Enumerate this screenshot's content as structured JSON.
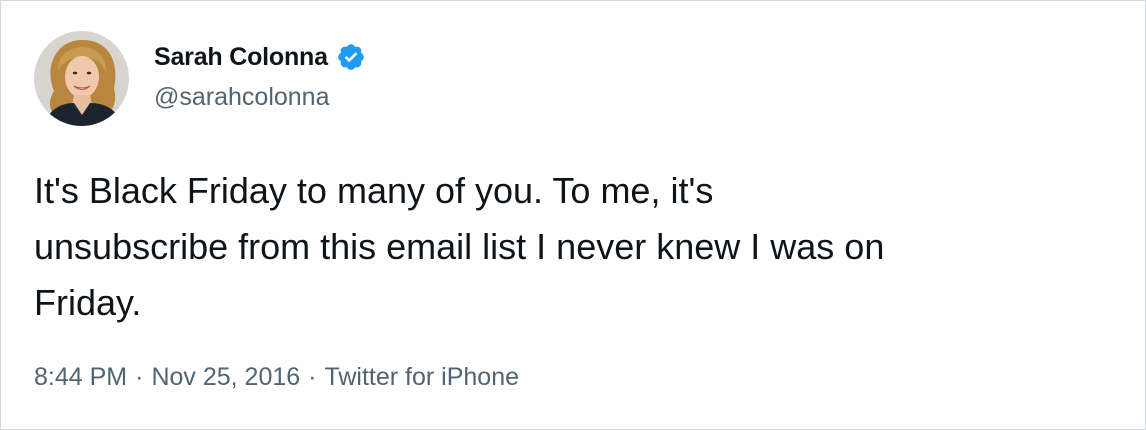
{
  "author": {
    "display_name": "Sarah Colonna",
    "handle": "@sarahcolonna",
    "avatar_icon": "profile-photo",
    "verified_icon": "verified-badge-icon",
    "verified_color": "#1d9bf0"
  },
  "tweet": {
    "text": "It's Black Friday to many of you. To me, it's\nunsubscribe from this email list I never knew I was on\nFriday."
  },
  "meta": {
    "time": "8:44 PM",
    "separator": "·",
    "date": "Nov 25, 2016",
    "source": "Twitter for iPhone"
  },
  "colors": {
    "text_primary": "#0f1419",
    "text_secondary": "#536471",
    "border": "#cfd9de"
  }
}
